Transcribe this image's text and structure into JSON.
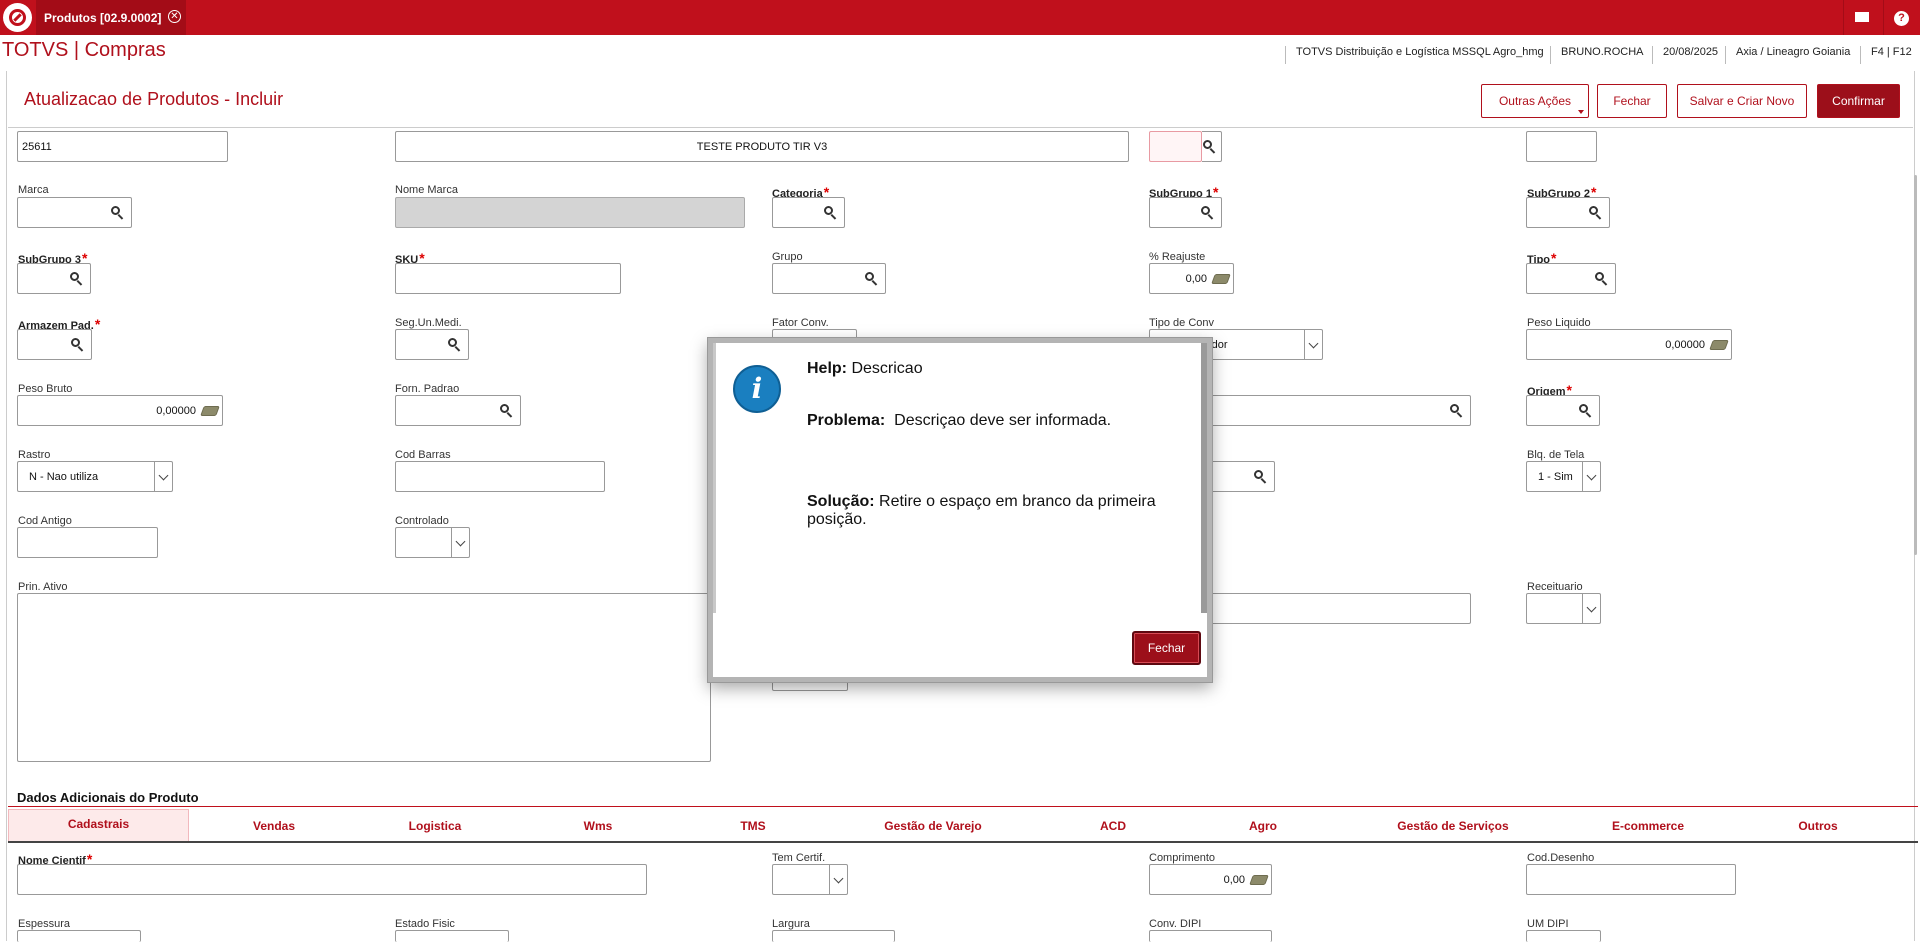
{
  "topbar": {
    "tab_label": "Produtos [02.9.0002]",
    "close_symbol": "✕",
    "mail_icon": "mail-icon",
    "help_symbol": "?"
  },
  "header": {
    "app_title": "TOTVS | Compras",
    "environment": "TOTVS Distribuição e Logística MSSQL Agro_hmg",
    "user": "BRUNO.ROCHA",
    "date": "20/08/2025",
    "branch": "Axia / Lineagro Goiania",
    "shortcuts": "F4 | F12"
  },
  "page": {
    "title": "Atualizacao de Produtos - Incluir",
    "buttons": {
      "outras_acoes": "Outras Ações",
      "fechar": "Fechar",
      "salvar_novo": "Salvar e Criar Novo",
      "confirmar": "Confirmar"
    }
  },
  "form": {
    "codigo_value": "25611",
    "descricao_value": "TESTE PRODUTO TIR V3",
    "marca_label": "Marca",
    "nome_marca_label": "Nome Marca",
    "categoria_label": "Categoria",
    "subgrupo1_label": "SubGrupo 1",
    "subgrupo2_label": "SubGrupo 2",
    "subgrupo3_label": "SubGrupo 3",
    "sku_label": "SKU",
    "grupo_label": "Grupo",
    "reajuste_label": "% Reajuste",
    "reajuste_value": "0,00",
    "tipo_label": "Tipo",
    "armazem_label": "Armazem Pad.",
    "seg_un_label": "Seg.Un.Medi.",
    "fator_conv_label": "Fator Conv.",
    "tipo_conv_label": "Tipo de Conv",
    "tipo_conv_value": "cador",
    "peso_liquido_label": "Peso Liquido",
    "peso_liquido_value": "0,00000",
    "peso_bruto_label": "Peso Bruto",
    "peso_bruto_value": "0,00000",
    "forn_padrao_label": "Forn. Padrao",
    "origem_label": "Origem",
    "rastro_label": "Rastro",
    "rastro_value": "N - Nao utiliza",
    "cod_barras_label": "Cod Barras",
    "blq_tela_label": "Blq. de Tela",
    "blq_tela_value": "1 - Sim",
    "cod_antigo_label": "Cod Antigo",
    "controlado_label": "Controlado",
    "prin_ativo_label": "Prin. Ativo",
    "receituario_label": "Receituario"
  },
  "additional": {
    "section_title": "Dados Adicionais do Produto",
    "tabs": [
      "Cadastrais",
      "Vendas",
      "Logistica",
      "Wms",
      "TMS",
      "Gestão de Varejo",
      "ACD",
      "Agro",
      "Gestão de Serviços",
      "E-commerce",
      "Outros"
    ],
    "nome_cientif_label": "Nome Cientif",
    "tem_certif_label": "Tem Certif.",
    "comprimento_label": "Comprimento",
    "comprimento_value": "0,00",
    "cod_desenho_label": "Cod.Desenho",
    "espessura_label": "Espessura",
    "estado_fisic_label": "Estado Fisic",
    "largura_label": "Largura",
    "conv_dipi_label": "Conv. DIPI",
    "um_dipi_label": "UM DIPI"
  },
  "dialog": {
    "help_label": "Help:",
    "help_value": "Descricao",
    "problema_label": "Problema:",
    "problema_value": "Descriçao deve ser informada.",
    "solucao_label": "Solução:",
    "solucao_value": "Retire o espaço em branco da primeira",
    "solucao_value_2": "posição.",
    "close_button": "Fechar",
    "icon_glyph": "i"
  },
  "colors": {
    "brand_red": "#c0101c",
    "button_red": "#9c0f1a",
    "info_blue": "#1a7fc0"
  }
}
